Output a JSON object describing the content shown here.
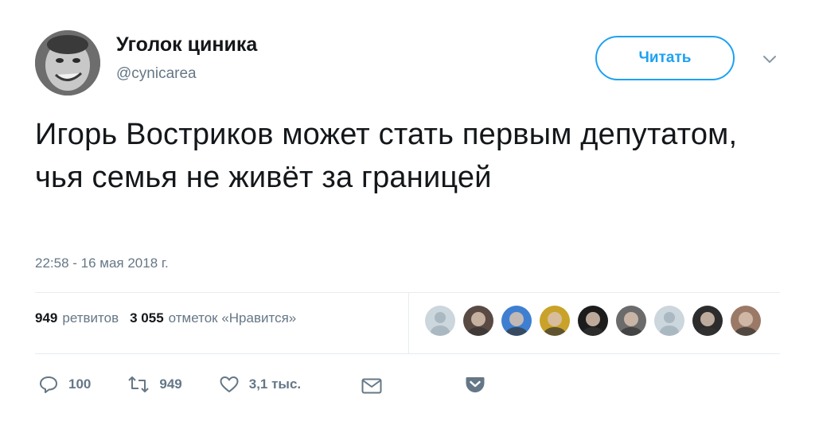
{
  "header": {
    "display_name": "Уголок циника",
    "handle": "@cynicarea",
    "follow_label": "Читать",
    "avatar_icon": "face-avatar",
    "more_icon": "chevron-down-icon"
  },
  "tweet": {
    "text": "Игорь Востриков может стать первым депутатом, чья семья не живёт за границей",
    "timestamp": "22:58 - 16 мая 2018 г."
  },
  "stats": {
    "retweets_count": "949",
    "retweets_label": "ретвитов",
    "likes_count": "3 055",
    "likes_label": "отметок «Нравится»"
  },
  "likers": [
    {
      "kind": "placeholder",
      "color": "#aab8c2"
    },
    {
      "kind": "photo",
      "color": "#5a4a44"
    },
    {
      "kind": "photo",
      "color": "#3f7fd1"
    },
    {
      "kind": "photo",
      "color": "#c9a22a"
    },
    {
      "kind": "photo",
      "color": "#1c1c1c"
    },
    {
      "kind": "photo",
      "color": "#6b6b6b"
    },
    {
      "kind": "placeholder",
      "color": "#aab8c2"
    },
    {
      "kind": "photo",
      "color": "#2c2c2c"
    },
    {
      "kind": "photo",
      "color": "#9a7a66"
    }
  ],
  "actions": {
    "reply_count": "100",
    "retweet_count": "949",
    "like_count": "3,1 тыс.",
    "reply_icon": "reply-icon",
    "retweet_icon": "retweet-icon",
    "like_icon": "heart-icon",
    "dm_icon": "envelope-icon",
    "pocket_icon": "pocket-icon"
  },
  "colors": {
    "accent": "#1da1f2",
    "text": "#14171a",
    "muted": "#657786",
    "divider": "#e6ecf0"
  }
}
